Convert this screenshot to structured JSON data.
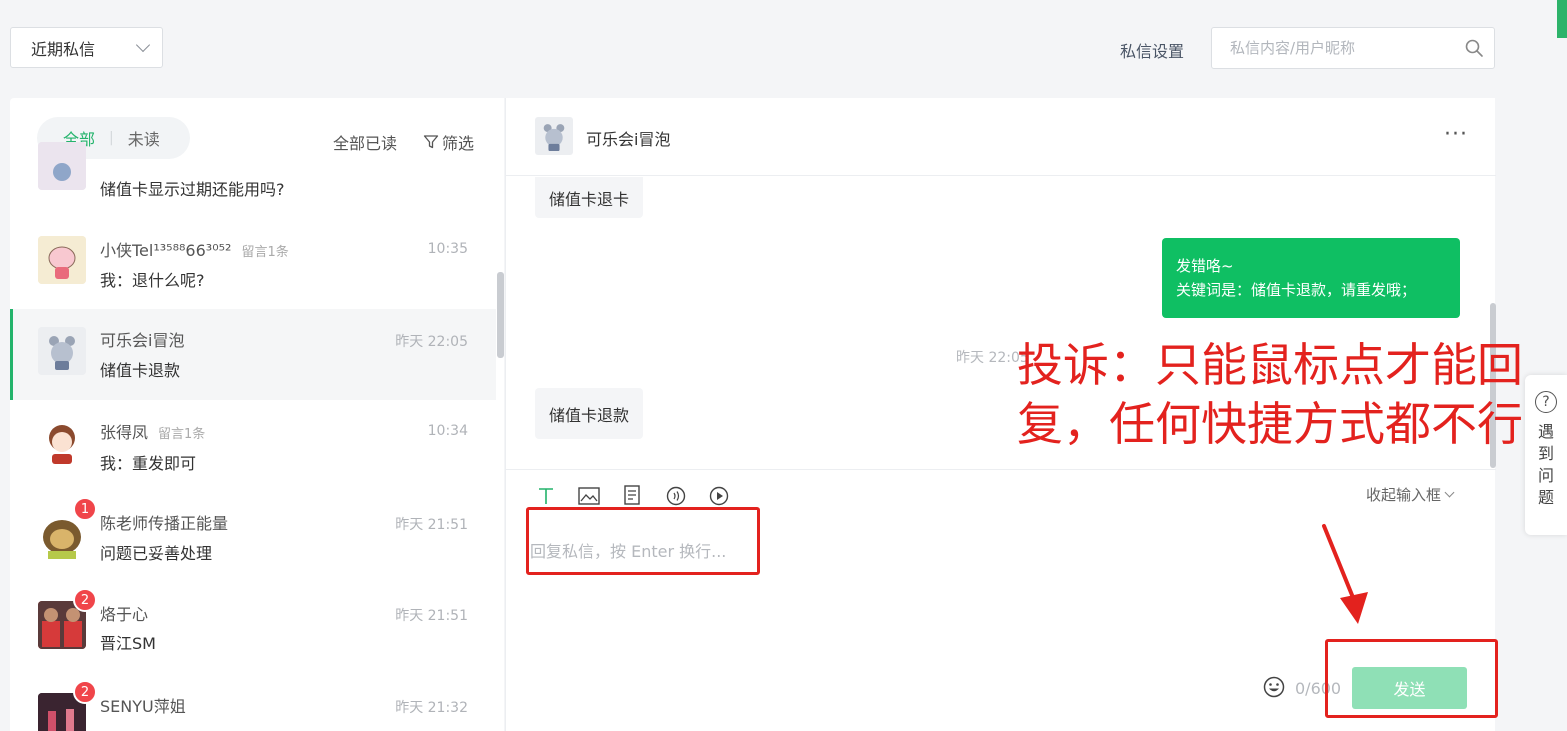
{
  "topbar": {
    "filter_value": "近期私信",
    "settings_label": "私信设置",
    "search_placeholder": "私信内容/用户昵称"
  },
  "list": {
    "tab_all": "全部",
    "tab_unread": "未读",
    "mark_all_read": "全部已读",
    "filter_label": "筛选",
    "conversations": [
      {
        "name": "",
        "tag": "",
        "time": "",
        "message": "储值卡显示过期还能用吗?",
        "badge": ""
      },
      {
        "name": "小侠Tel¹³⁵⁸⁸66³⁰⁵²",
        "tag": "留言1条",
        "time": "10:35",
        "message": "我：退什么呢?",
        "badge": ""
      },
      {
        "name": "可乐会i冒泡",
        "tag": "",
        "time": "昨天 22:05",
        "message": "储值卡退款",
        "badge": ""
      },
      {
        "name": "张得凤",
        "tag": "留言1条",
        "time": "10:34",
        "message": "我：重发即可",
        "badge": ""
      },
      {
        "name": "陈老师传播正能量",
        "tag": "",
        "time": "昨天 21:51",
        "message": "问题已妥善处理",
        "badge": "1"
      },
      {
        "name": "烙于心",
        "tag": "",
        "time": "昨天 21:51",
        "message": "晋江SM",
        "badge": "2"
      },
      {
        "name": "SENYU萍姐",
        "tag": "",
        "time": "昨天 21:32",
        "message": "",
        "badge": "2"
      }
    ]
  },
  "chat": {
    "contact_name": "可乐会i冒泡",
    "more_label": "···",
    "messages": {
      "in_1": "储值卡退卡",
      "out_line1": "发错咯~",
      "out_line2": "关键词是：储值卡退款，请重发哦；",
      "timestamp": "昨天 22:05",
      "in_2": "储值卡退款"
    },
    "collapse_label": "收起输入框",
    "reply_placeholder": "回复私信，按 Enter 换行...",
    "counter": "0/600",
    "send_label": "发送"
  },
  "help": {
    "icon": "?",
    "label": "遇到问题"
  },
  "annotation": {
    "text": "投诉：只能鼠标点才能回复，任何快捷方式都不行",
    "color": "#e3221e"
  },
  "colors": {
    "accent": "#23b36b",
    "send_disabled": "#8fe0b6",
    "outgoing_bubble": "#0fbf63",
    "badge": "#f0454a"
  }
}
